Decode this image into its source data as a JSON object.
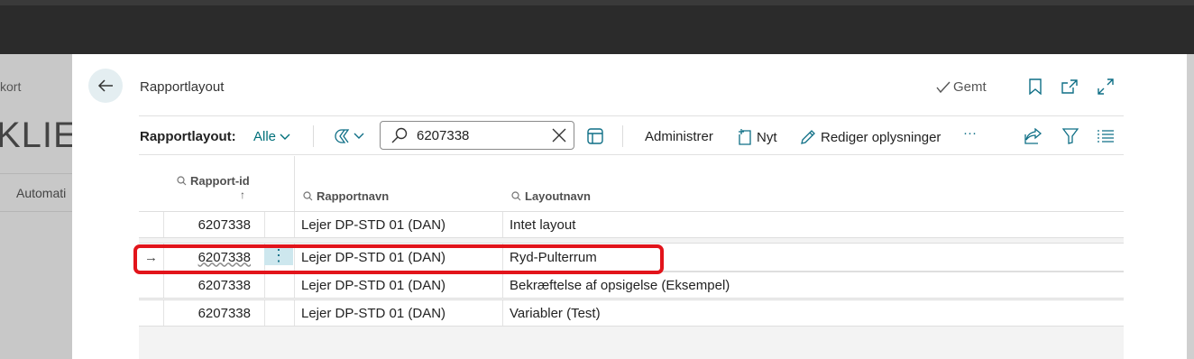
{
  "background": {
    "crumb": "kort",
    "title": "KLIEN",
    "tab": "Automati"
  },
  "dialog": {
    "title": "Rapportlayout",
    "saved_label": "Gemt"
  },
  "action_bar": {
    "label": "Rapportlayout:",
    "filter_value": "Alle",
    "search_value": "6207338",
    "manage_label": "Administrer",
    "new_label": "Nyt",
    "edit_label": "Rediger oplysninger",
    "more_label": "···"
  },
  "grid": {
    "columns": {
      "report_id": "Rapport-id",
      "sort_indicator": "↑",
      "report_name": "Rapportnavn",
      "layout_name": "Layoutnavn"
    },
    "rows": [
      {
        "id": "6207338",
        "report_name": "Lejer DP-STD 01 (DAN)",
        "layout_name": "Intet layout",
        "selected": false
      },
      {
        "id": "6207338",
        "report_name": "Lejer DP-STD 01 (DAN)",
        "layout_name": "Ryd-Pulterrum",
        "selected": true
      },
      {
        "id": "6207338",
        "report_name": "Lejer DP-STD 01 (DAN)",
        "layout_name": "Bekræftelse af opsigelse (Eksempel)",
        "selected": false
      },
      {
        "id": "6207338",
        "report_name": "Lejer DP-STD 01 (DAN)",
        "layout_name": "Variabler (Test)",
        "selected": false
      }
    ],
    "row_indicator": "→",
    "row_menu_glyph": "⋮"
  },
  "colors": {
    "accent": "#00707a",
    "highlight": "#e2141b",
    "selection": "#cde7ee"
  },
  "icons": [
    "back-arrow-icon",
    "checkmark-icon",
    "bookmark-icon",
    "open-new-window-icon",
    "expand-icon",
    "views-icon",
    "search-icon",
    "clear-icon",
    "list-view-icon",
    "new-document-icon",
    "pencil-icon",
    "share-icon",
    "filter-icon",
    "list-icon"
  ]
}
